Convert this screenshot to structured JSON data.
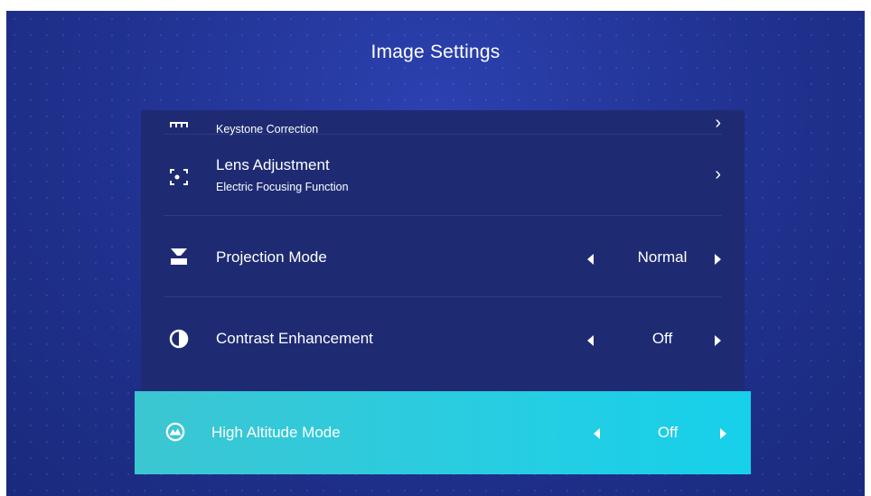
{
  "header": {
    "title": "Image Settings"
  },
  "items": [
    {
      "label": "",
      "sublabel": "Keystone Correction",
      "icon": "keystone-icon"
    },
    {
      "label": "Lens Adjustment",
      "sublabel": "Electric Focusing Function",
      "icon": "focus-icon"
    },
    {
      "label": "Projection Mode",
      "value": "Normal",
      "icon": "projection-icon"
    },
    {
      "label": "Contrast Enhancement",
      "value": "Off",
      "icon": "contrast-icon"
    },
    {
      "label": "High Altitude Mode",
      "value": "Off",
      "icon": "mountain-icon"
    }
  ],
  "colors": {
    "background": "#20318f",
    "panel": "#1e2b73",
    "selected": "#27cde2",
    "text": "#ffffff"
  }
}
